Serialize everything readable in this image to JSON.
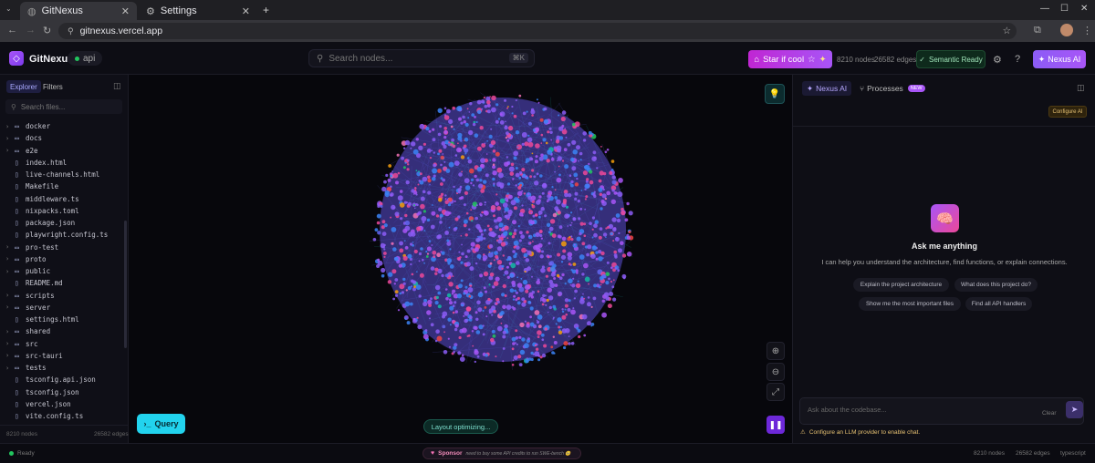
{
  "browser": {
    "tabs": [
      {
        "title": "GitNexus",
        "active": true
      },
      {
        "title": "Settings",
        "active": false
      }
    ],
    "new_tab": "+",
    "url": "gitnexus.vercel.app",
    "window_controls": {
      "minimize": "—",
      "maximize": "☐",
      "close": "✕"
    }
  },
  "header": {
    "brand": "GitNexus",
    "repo": "api",
    "search_placeholder": "Search nodes...",
    "search_shortcut": "⌘K",
    "star_label": "Star if cool",
    "nodes_stat": "8210 nodes",
    "edges_stat": "26582 edges",
    "semantic_status": "Semantic Ready",
    "nexus_ai_label": "Nexus AI",
    "colors": {
      "accent": "#a855f7",
      "ready": "#22c55e"
    }
  },
  "sidebar": {
    "tabs": [
      "Explorer",
      "Filters"
    ],
    "search_placeholder": "Search files...",
    "items": [
      {
        "name": "docker",
        "type": "folder"
      },
      {
        "name": "docs",
        "type": "folder"
      },
      {
        "name": "e2e",
        "type": "folder"
      },
      {
        "name": "index.html",
        "type": "file"
      },
      {
        "name": "live-channels.html",
        "type": "file"
      },
      {
        "name": "Makefile",
        "type": "file"
      },
      {
        "name": "middleware.ts",
        "type": "file"
      },
      {
        "name": "nixpacks.toml",
        "type": "file"
      },
      {
        "name": "package.json",
        "type": "file"
      },
      {
        "name": "playwright.config.ts",
        "type": "file"
      },
      {
        "name": "pro-test",
        "type": "folder"
      },
      {
        "name": "proto",
        "type": "folder"
      },
      {
        "name": "public",
        "type": "folder"
      },
      {
        "name": "README.md",
        "type": "file"
      },
      {
        "name": "scripts",
        "type": "folder"
      },
      {
        "name": "server",
        "type": "folder"
      },
      {
        "name": "settings.html",
        "type": "file"
      },
      {
        "name": "shared",
        "type": "folder"
      },
      {
        "name": "src",
        "type": "folder"
      },
      {
        "name": "src-tauri",
        "type": "folder"
      },
      {
        "name": "tests",
        "type": "folder"
      },
      {
        "name": "tsconfig.api.json",
        "type": "file"
      },
      {
        "name": "tsconfig.json",
        "type": "file"
      },
      {
        "name": "vercel.json",
        "type": "file"
      },
      {
        "name": "vite.config.ts",
        "type": "file"
      }
    ],
    "footer_nodes": "8210 nodes",
    "footer_edges": "26582 edges"
  },
  "graph": {
    "query_label": "Query",
    "layout_status": "Layout optimizing...",
    "node_colors": [
      "#8b5cf6",
      "#6366f1",
      "#3b82f6",
      "#ec4899",
      "#f472b6",
      "#a855f7",
      "#22c55e",
      "#f59e0b",
      "#14b8a6",
      "#ef4444"
    ]
  },
  "right_panel": {
    "tabs": [
      {
        "label": "Nexus AI",
        "active": true
      },
      {
        "label": "Processes",
        "active": false,
        "badge": "NEW"
      }
    ],
    "configure_label": "Configure AI",
    "ask_title": "Ask me anything",
    "ask_subtitle": "I can help you understand the architecture, find functions, or explain connections.",
    "suggestions": [
      "Explain the project architecture",
      "What does this project do?",
      "Show me the most important files",
      "Find all API handlers"
    ],
    "chat_placeholder": "Ask about the codebase...",
    "clear_label": "Clear",
    "warning": "Configure an LLM provider to enable chat."
  },
  "statusbar": {
    "ready": "Ready",
    "sponsor_label": "Sponsor",
    "sponsor_message": "need to buy some API credits to run SWE-bench 🥺",
    "nodes": "8210 nodes",
    "edges": "26582 edges",
    "language": "typescript"
  }
}
